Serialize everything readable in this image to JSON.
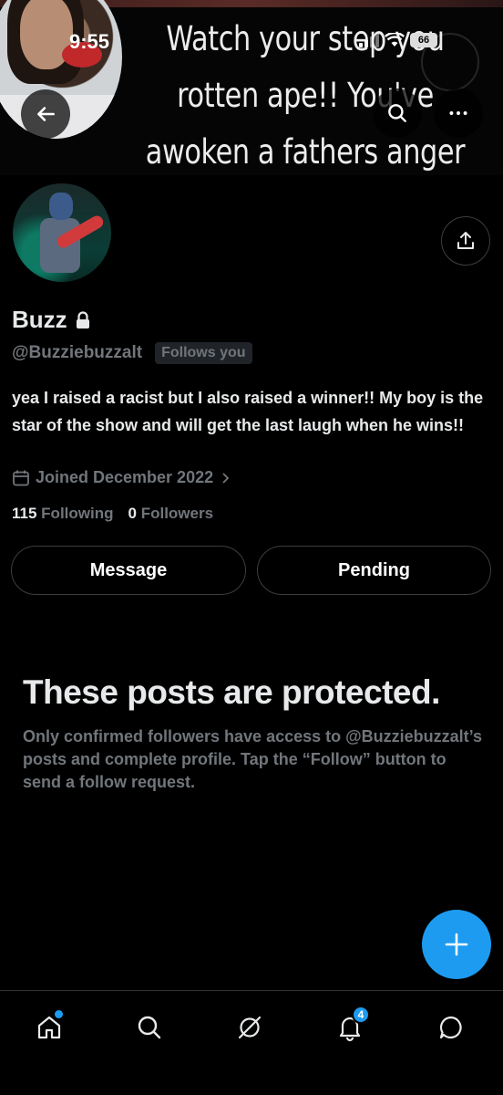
{
  "banner": {
    "lines": [
      "Watch your step you",
      "rotten ape!! You've",
      "awoken a fathers anger"
    ]
  },
  "status_bar": {
    "time": "9:55",
    "battery": "66"
  },
  "profile": {
    "name": "Buzz",
    "handle": "@Buzziebuzzalt",
    "follows_you": "Follows you",
    "bio": "yea I raised a racist but I also raised a winner!! My boy is the star of the show and will get the last laugh when he wins!!",
    "joined": "Joined December 2022",
    "following_count": "115",
    "following_label": "Following",
    "followers_count": "0",
    "followers_label": "Followers"
  },
  "actions": {
    "message": "Message",
    "pending": "Pending"
  },
  "protected": {
    "title": "These posts are protected.",
    "description": "Only confirmed followers have access to @Buzziebuzzalt’s posts and complete profile. Tap the “Follow” button to send a follow request."
  },
  "bottom_nav": {
    "notifications_badge": "4"
  },
  "colors": {
    "accent": "#1d9bf0",
    "background": "#000000",
    "muted_text": "#71767b"
  },
  "icons": [
    "back-arrow-icon",
    "search-icon",
    "more-icon",
    "share-icon",
    "lock-icon",
    "calendar-icon",
    "chevron-right-icon",
    "plus-icon",
    "home-icon",
    "search-icon",
    "grok-icon",
    "bell-icon",
    "chat-icon"
  ]
}
